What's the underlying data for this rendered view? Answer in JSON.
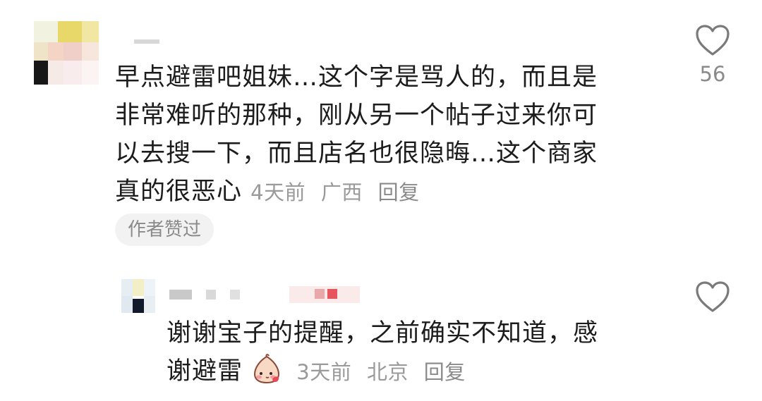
{
  "comment": {
    "lines": [
      "早点避雷吧姐妹…这个字是骂人的，而且是",
      "非常难听的那种，刚从另一个帖子过来你可",
      "以去搜一下，而且店名也很隐晦…这个商家",
      "真的很恶心"
    ],
    "time": "4天前",
    "location": "广西",
    "reply_label": "回复",
    "badge": "作者赞过",
    "like_count": "56",
    "icon": "heart-outline-icon"
  },
  "reply": {
    "lines": [
      "谢谢宝子的提醒，之前确实不知道，感",
      "谢避雷"
    ],
    "emoji": "blushing-face-emoji",
    "time": "3天前",
    "location": "北京",
    "reply_label": "回复",
    "icon": "heart-outline-icon"
  },
  "colors": {
    "text": "#1c1c1c",
    "meta": "#9a9a9a",
    "badge_bg": "#f2f2f2"
  }
}
